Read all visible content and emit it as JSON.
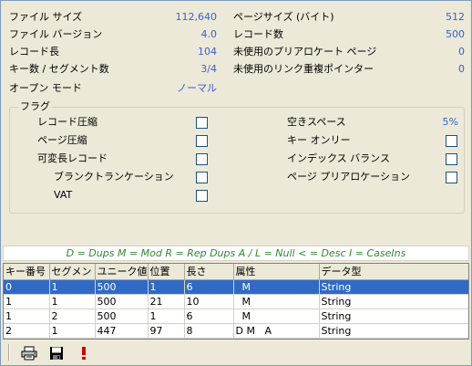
{
  "props_left": [
    {
      "label": "ファイル サイズ",
      "value": "112,640"
    },
    {
      "label": "ファイル バージョン",
      "value": "4.0"
    },
    {
      "label": "レコード長",
      "value": "104"
    },
    {
      "label": "キー数 / セグメント数",
      "value": "3/4"
    },
    {
      "label": "オープン モード",
      "value": "ノーマル"
    }
  ],
  "props_right": [
    {
      "label": "ページサイズ (バイト)",
      "value": "512"
    },
    {
      "label": "レコード数",
      "value": "500"
    },
    {
      "label": "未使用のプリアロケート ページ",
      "value": "0"
    },
    {
      "label": "未使用のリンク重複ポインター",
      "value": "0"
    }
  ],
  "flags": {
    "title": "フラグ",
    "left": [
      {
        "label": "レコード圧縮",
        "checked": false
      },
      {
        "label": "ページ圧縮",
        "checked": false
      },
      {
        "label": "可変長レコード",
        "checked": false
      },
      {
        "label": "ブランクトランケーション",
        "checked": false
      },
      {
        "label": "VAT",
        "checked": false
      }
    ],
    "free_space_label": "空きスペース",
    "free_space_value": "5%",
    "right": [
      {
        "label": "キー オンリー",
        "checked": false
      },
      {
        "label": "インデックス バランス",
        "checked": false
      },
      {
        "label": "ページ プリアロケーション",
        "checked": false
      }
    ]
  },
  "legend": "D = Dups   M = Mod   R = Rep  Dups   A / L = Null   < = Desc   I = CaseIns",
  "table": {
    "columns": [
      "キー番号",
      "セグメント",
      "ユニーク値",
      "位置",
      "長さ",
      "属性",
      "データ型"
    ],
    "rows": [
      [
        "0",
        "1",
        "500",
        "1",
        "6",
        "  M",
        "String"
      ],
      [
        "1",
        "1",
        "500",
        "21",
        "10",
        "  M",
        "String"
      ],
      [
        "1",
        "2",
        "500",
        "1",
        "6",
        "  M",
        "String"
      ],
      [
        "2",
        "1",
        "447",
        "97",
        "8",
        "D M   A",
        "String"
      ]
    ],
    "selected_row": 0
  },
  "toolbar": {
    "buttons": [
      "printer-icon",
      "save-icon",
      "alert-icon"
    ]
  },
  "colors": {
    "value_blue": "#3a5fcd",
    "legend_green": "#2e8b2e",
    "selection": "#316ac5"
  }
}
